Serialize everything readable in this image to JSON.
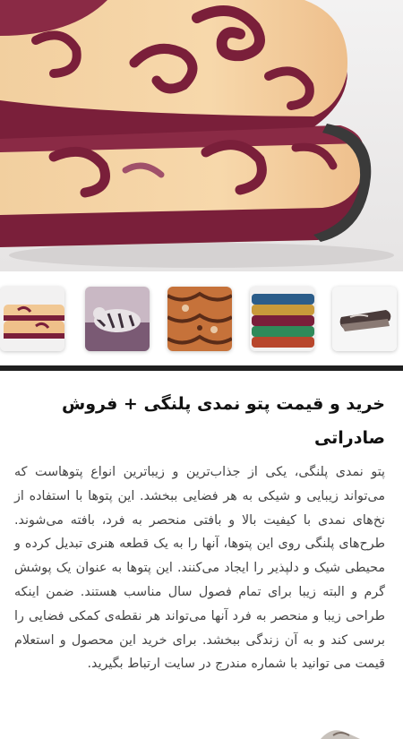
{
  "product": {
    "title": "خرید و قیمت پتو نمدی پلنگی + فروش صادراتی",
    "description": "پتو نمدی پلنگی، یکی از جذاب‌ترین و زیباترین انواع پتوهاست که می‌تواند زیبایی و شیکی به هر فضایی ببخشد. این پتوها با استفاده از نخ‌های نمدی با کیفیت بالا و بافتی منحصر به فرد، بافته می‌شوند. طرح‌های پلنگی روی این پتوها، آنها را به یک قطعه هنری تبدیل کرده و محیطی شیک و دلپذیر را ایجاد می‌کنند. این پتوها به عنوان یک پوشش گرم و البته زیبا برای تمام فصول سال مناسب هستند. ضمن اینکه طراحی زیبا و منحصر به فرد آنها می‌تواند هر نقطه‌ی کمکی فضایی را برسی کند و به آن زندگی ببخشد. برای خرید این محصول و استعلام قیمت می توانید با شماره مندرج در سایت ارتباط بگیرید."
  },
  "gallery": {
    "main_image": "folded-paisley-blanket",
    "thumbnails": [
      "paisley-blanket",
      "tiger-blanket",
      "leopard-pattern-blanket",
      "stacked-colored-blankets",
      "folded-dark-blanket"
    ]
  },
  "colors": {
    "blanket_cream": "#efc99a",
    "blanket_maroon": "#7a1f3a",
    "divider": "#1f1f1f"
  }
}
